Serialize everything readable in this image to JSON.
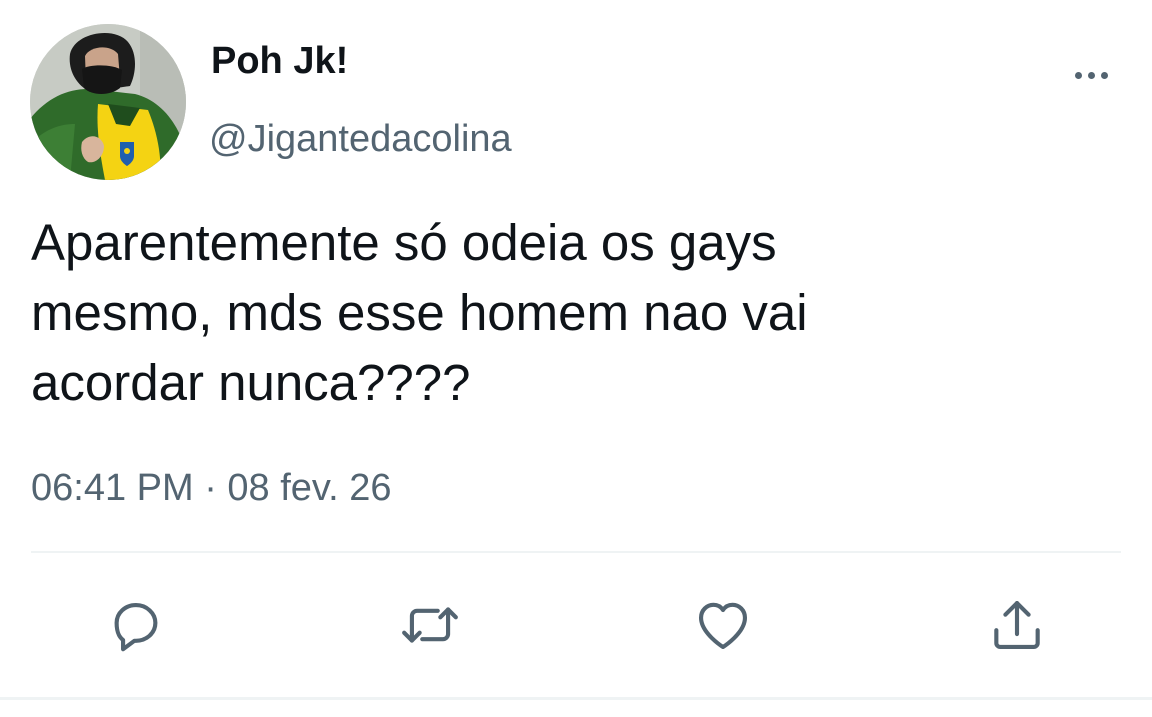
{
  "tweet": {
    "display_name": "Poh Jk!",
    "handle": "@Jigantedacolina",
    "text_lines": [
      "Aparentemente só odeia os gays",
      "mesmo, mds esse homem nao vai",
      "acordar nunca????"
    ],
    "timestamp": "06:41 PM · 08 fev. 26"
  },
  "icons": {
    "more": "more-horizontal-icon",
    "reply": "reply-icon",
    "retweet": "retweet-icon",
    "like": "heart-icon",
    "share": "share-icon"
  },
  "colors": {
    "text_primary": "#0f1419",
    "text_secondary": "#536471",
    "divider": "#eff3f4"
  }
}
